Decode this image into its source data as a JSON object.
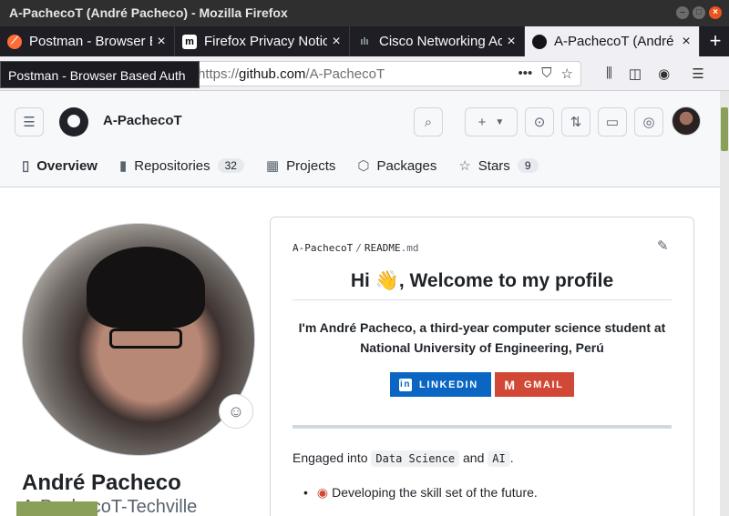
{
  "window": {
    "title": "A-PachecoT (André Pacheco) - Mozilla Firefox"
  },
  "tabs": [
    {
      "label": "Postman - Browser Based Auth",
      "favicon": "postman-icon",
      "active": false
    },
    {
      "label": "Firefox Privacy Notice",
      "favicon": "mozilla-icon",
      "active": false
    },
    {
      "label": "Cisco Networking Academy",
      "favicon": "cisco-icon",
      "active": false
    },
    {
      "label": "A-PachecoT (André Pacheco)",
      "favicon": "github-icon",
      "active": true
    }
  ],
  "tooltip": "Postman - Browser Based Auth",
  "address_bar": {
    "scheme": "https://",
    "host": "github.com",
    "path": "/A-PachecoT"
  },
  "github": {
    "username": "A-PachecoT",
    "nav": [
      {
        "label": "Overview",
        "icon": "book-icon",
        "selected": true
      },
      {
        "label": "Repositories",
        "icon": "repo-icon",
        "count": "32"
      },
      {
        "label": "Projects",
        "icon": "table-icon"
      },
      {
        "label": "Packages",
        "icon": "package-icon"
      },
      {
        "label": "Stars",
        "icon": "star-icon",
        "count": "9"
      }
    ],
    "profile": {
      "full_name": "André Pacheco",
      "subtitle": "A-PachecoT-Techville"
    },
    "readme": {
      "path_user": "A-PachecoT",
      "path_sep": "/",
      "path_file": "README",
      "path_ext": ".md",
      "heading": "Hi 👋, Welcome to my profile",
      "intro": "I'm André Pacheco, a third-year computer science student at National University of Engineering, Perú",
      "badges": {
        "linkedin": "LINKEDIN",
        "gmail": "GMAIL"
      },
      "engaged_prefix": "Engaged into",
      "engaged_code1": "Data Science",
      "engaged_and": "and",
      "engaged_code2": "AI",
      "engaged_suffix": ".",
      "bullet1": "Developing the skill set of the future."
    }
  },
  "colors": {
    "linkedin": "#0a66c2",
    "gmail": "#d14836",
    "accent_scroll": "#8aa058"
  }
}
